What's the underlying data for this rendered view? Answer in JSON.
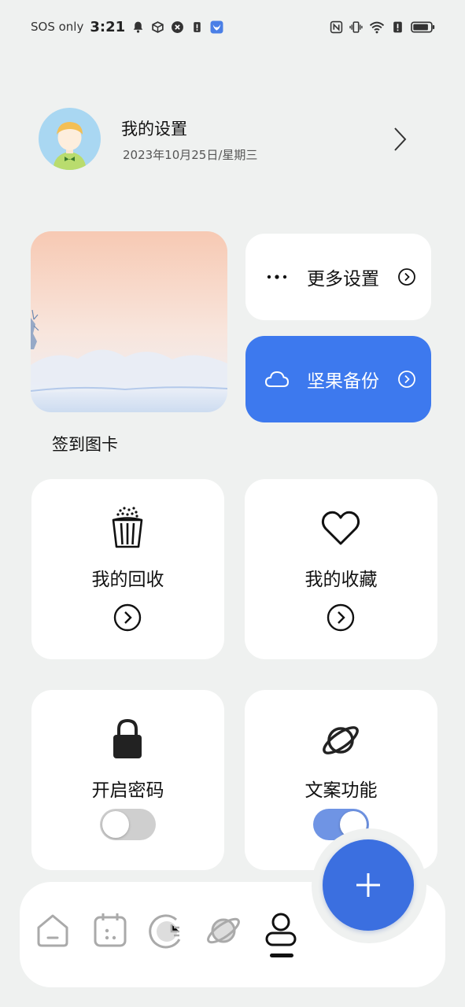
{
  "status_bar": {
    "carrier": "SOS only",
    "time": "3:21"
  },
  "profile": {
    "title": "我的设置",
    "date": "2023年10月25日/星期三"
  },
  "signin": {
    "label": "签到图卡"
  },
  "quick_actions": {
    "more_settings": "更多设置",
    "backup": "坚果备份"
  },
  "cards": {
    "recycle": "我的回收",
    "favorites": "我的收藏",
    "password": "开启密码",
    "copywriting": "文案功能"
  },
  "toggles": {
    "password_on": false,
    "copywriting_on": true
  },
  "colors": {
    "accent": "#3d79ee",
    "fab": "#3b6fe0",
    "background": "#eff1f0",
    "toggle_on": "#6f94e4"
  },
  "nav": {
    "items": [
      "home-icon",
      "calendar-icon",
      "clock-icon",
      "planet-icon",
      "profile-icon"
    ],
    "active": "profile-icon"
  }
}
